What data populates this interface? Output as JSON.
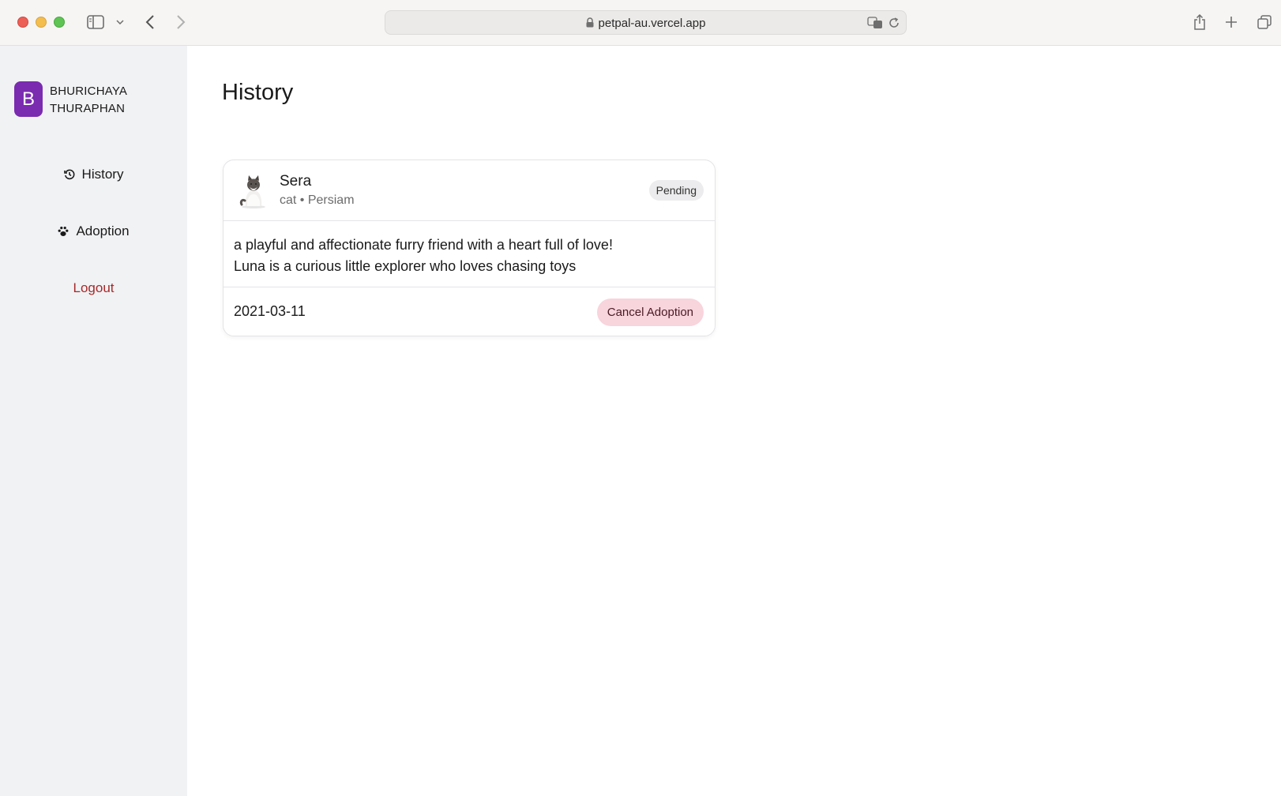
{
  "browser": {
    "url": "petpal-au.vercel.app"
  },
  "sidebar": {
    "avatar_letter": "B",
    "user_name_line1": "BHURICHAYA",
    "user_name_line2": "THURAPHAN",
    "items": [
      {
        "label": "History",
        "icon": "history-icon"
      },
      {
        "label": "Adoption",
        "icon": "paw-icon"
      },
      {
        "label": "Logout"
      }
    ]
  },
  "main": {
    "title": "History",
    "cards": [
      {
        "name": "Sera",
        "meta": "cat • Persiam",
        "status": "Pending",
        "description_line1": "a playful and affectionate furry friend with a heart full of love!",
        "description_line2": "Luna is a curious little explorer who loves chasing toys",
        "date": "2021-03-11",
        "action_label": "Cancel Adoption"
      }
    ]
  },
  "colors": {
    "avatar": "#7a2bb0",
    "logout": "#a52a2a",
    "cancel_button": "#f8d4dc",
    "sidebar_bg": "#f1f2f4"
  }
}
